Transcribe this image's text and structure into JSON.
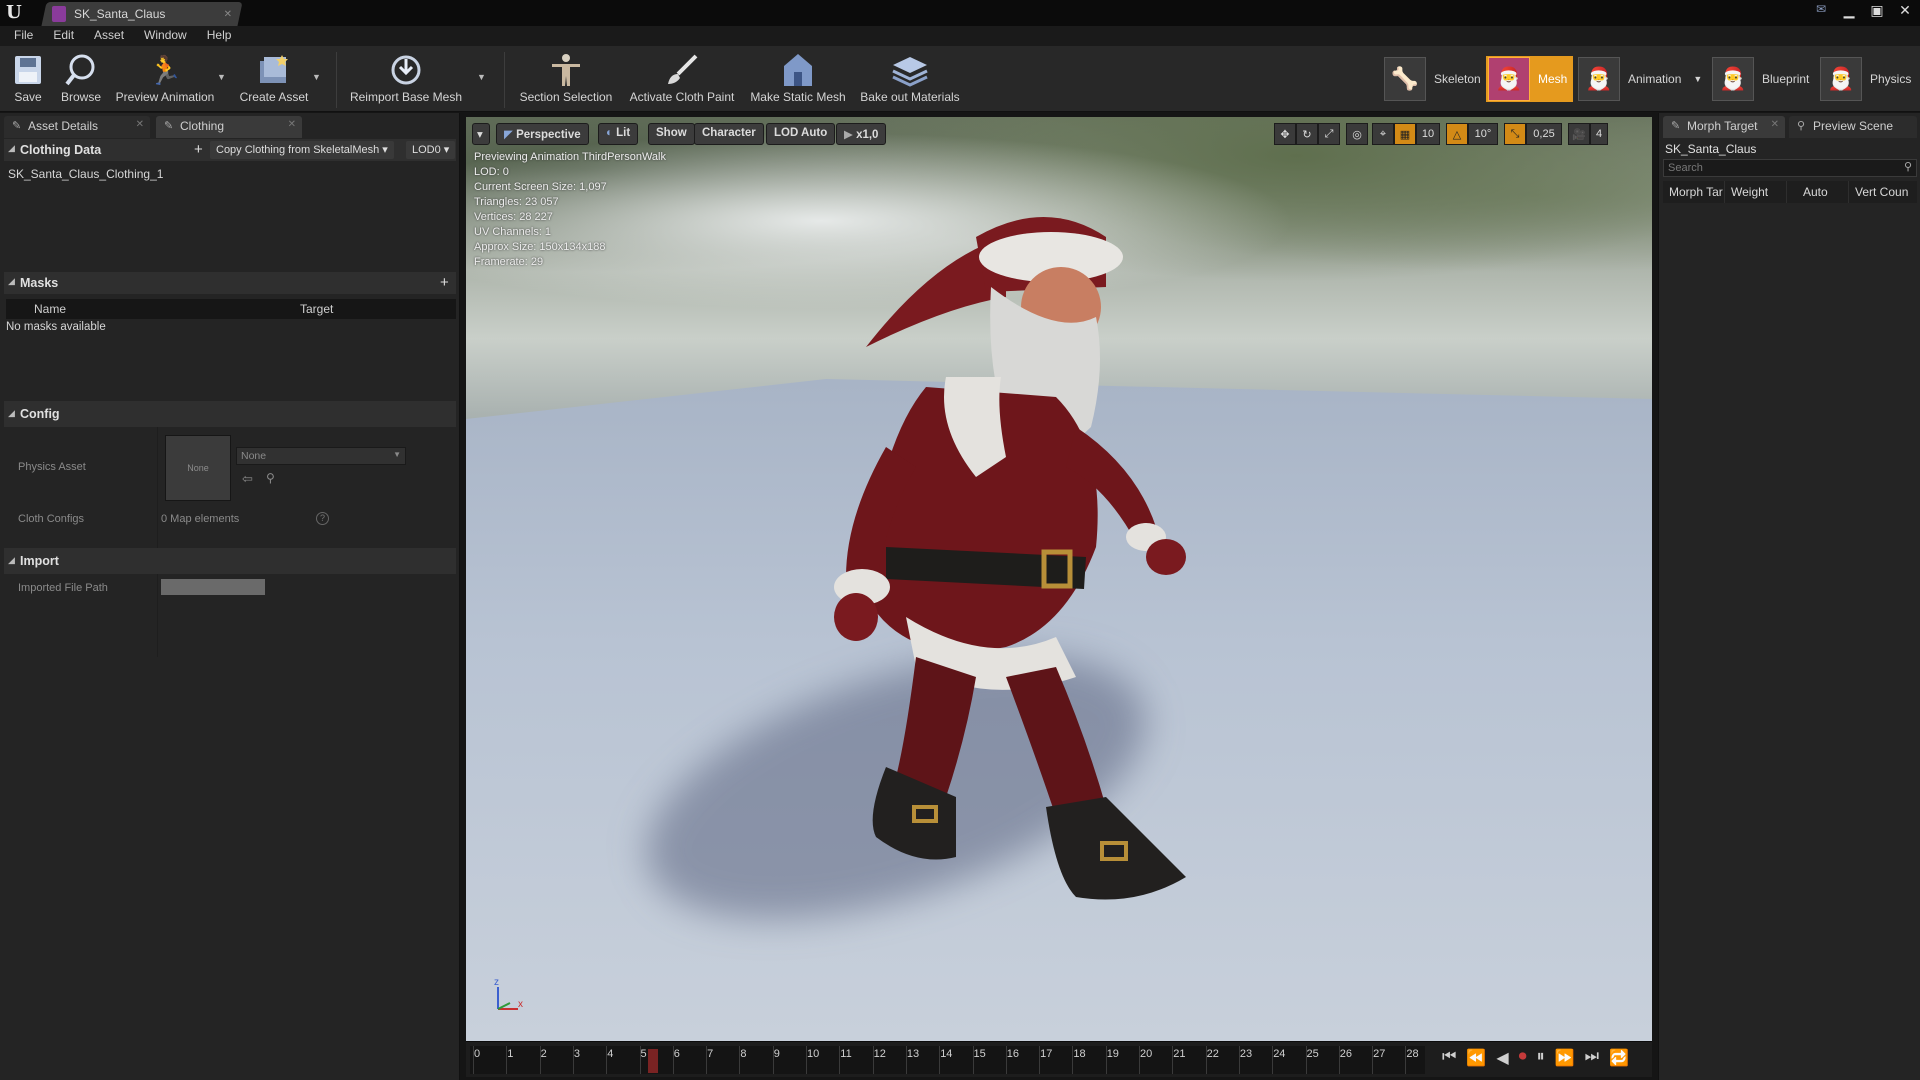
{
  "window": {
    "tab_title": "SK_Santa_Claus",
    "logo": "U",
    "controls": [
      "▁",
      "▣",
      "✕"
    ]
  },
  "menu": [
    "File",
    "Edit",
    "Asset",
    "Window",
    "Help"
  ],
  "toolbar": {
    "save": "Save",
    "browse": "Browse",
    "preview_animation": "Preview Animation",
    "create_asset": "Create Asset",
    "reimport": "Reimport Base Mesh",
    "section_selection": "Section Selection",
    "activate_cloth_paint": "Activate Cloth Paint",
    "make_static_mesh": "Make Static Mesh",
    "bake_out_materials": "Bake out Materials"
  },
  "modes": {
    "skeleton": "Skeleton",
    "mesh": "Mesh",
    "animation": "Animation",
    "blueprint": "Blueprint",
    "physics": "Physics",
    "active": "mesh"
  },
  "left_panel": {
    "tabs": [
      "Asset Details",
      "Clothing"
    ],
    "clothing_data": {
      "header": "Clothing Data",
      "copy_button": "Copy Clothing from SkeletalMesh",
      "lod": "LOD0",
      "item": "SK_Santa_Claus_Clothing_1"
    },
    "masks": {
      "header": "Masks",
      "col_name": "Name",
      "col_target": "Target",
      "empty": "No masks available"
    },
    "config": {
      "header": "Config",
      "physics_asset_label": "Physics Asset",
      "thumb_text": "None",
      "physics_asset_value": "None",
      "cloth_configs_label": "Cloth Configs",
      "cloth_configs_value": "0 Map elements"
    },
    "import": {
      "header": "Import",
      "imported_file_path_label": "Imported File Path"
    }
  },
  "viewport": {
    "buttons": {
      "perspective": "Perspective",
      "lit": "Lit",
      "show": "Show",
      "character": "Character",
      "lod_auto": "LOD Auto",
      "speed": "x1,0"
    },
    "tools": {
      "grid_snap": "10",
      "rot_snap": "10°",
      "scale_snap": "0,25",
      "cam_speed": "4"
    },
    "info": [
      "Previewing Animation ThirdPersonWalk",
      "LOD: 0",
      "Current Screen Size: 1,097",
      "Triangles: 23 057",
      "Vertices: 28 227",
      "UV Channels: 1",
      "Approx Size: 150x134x188",
      "Framerate: 29"
    ],
    "axes": {
      "z": "z",
      "x": "x"
    }
  },
  "timeline": {
    "frames": [
      "0",
      "1",
      "2",
      "3",
      "4",
      "5",
      "6",
      "7",
      "8",
      "9",
      "10",
      "11",
      "12",
      "13",
      "14",
      "15",
      "16",
      "17",
      "18",
      "19",
      "20",
      "21",
      "22",
      "23",
      "24",
      "25",
      "26",
      "27",
      "28"
    ],
    "current_frame": 5
  },
  "right_panel": {
    "tabs": [
      "Morph Target",
      "Preview Scene"
    ],
    "asset": "SK_Santa_Claus",
    "search_placeholder": "Search",
    "columns": [
      "Morph Tar",
      "Weight",
      "Auto",
      "Vert Coun"
    ]
  },
  "colors": {
    "accent": "#e59a1e",
    "background": "#242424",
    "santa_red": "#7a1a1f"
  }
}
